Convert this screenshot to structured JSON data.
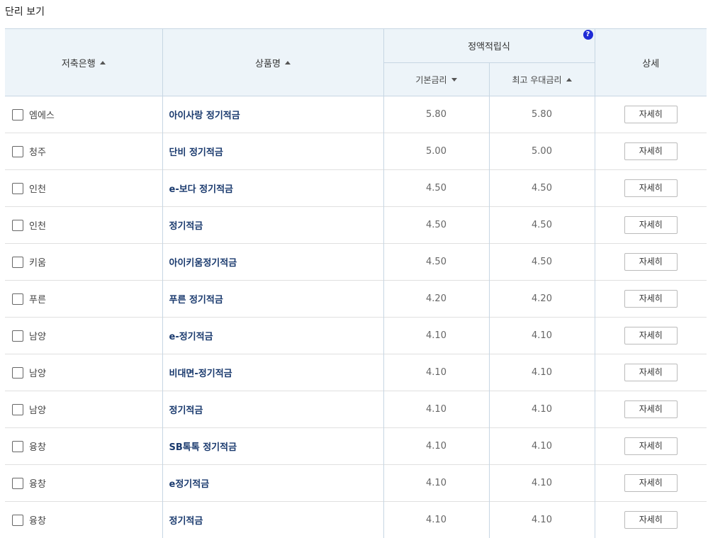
{
  "page": {
    "title": "단리 보기"
  },
  "header": {
    "bank": "저축은행",
    "product": "상품명",
    "group": "정액적립식",
    "help_icon": "?",
    "base_rate": "기본금리",
    "max_rate": "최고 우대금리",
    "detail": "상세"
  },
  "rows": [
    {
      "bank": "엠에스",
      "product": "아이사랑 정기적금",
      "base": "5.80",
      "max": "5.80",
      "button": "자세히"
    },
    {
      "bank": "청주",
      "product": "단비 정기적금",
      "base": "5.00",
      "max": "5.00",
      "button": "자세히"
    },
    {
      "bank": "인천",
      "product": "e-보다 정기적금",
      "base": "4.50",
      "max": "4.50",
      "button": "자세히"
    },
    {
      "bank": "인천",
      "product": "정기적금",
      "base": "4.50",
      "max": "4.50",
      "button": "자세히"
    },
    {
      "bank": "키움",
      "product": "아이키움정기적금",
      "base": "4.50",
      "max": "4.50",
      "button": "자세히"
    },
    {
      "bank": "푸른",
      "product": "푸른 정기적금",
      "base": "4.20",
      "max": "4.20",
      "button": "자세히"
    },
    {
      "bank": "남양",
      "product": "e-정기적금",
      "base": "4.10",
      "max": "4.10",
      "button": "자세히"
    },
    {
      "bank": "남양",
      "product": "비대면-정기적금",
      "base": "4.10",
      "max": "4.10",
      "button": "자세히"
    },
    {
      "bank": "남양",
      "product": "정기적금",
      "base": "4.10",
      "max": "4.10",
      "button": "자세히"
    },
    {
      "bank": "융창",
      "product": "SB톡톡 정기적금",
      "base": "4.10",
      "max": "4.10",
      "button": "자세히"
    },
    {
      "bank": "융창",
      "product": "e정기적금",
      "base": "4.10",
      "max": "4.10",
      "button": "자세히"
    },
    {
      "bank": "융창",
      "product": "정기적금",
      "base": "4.10",
      "max": "4.10",
      "button": "자세히"
    }
  ]
}
